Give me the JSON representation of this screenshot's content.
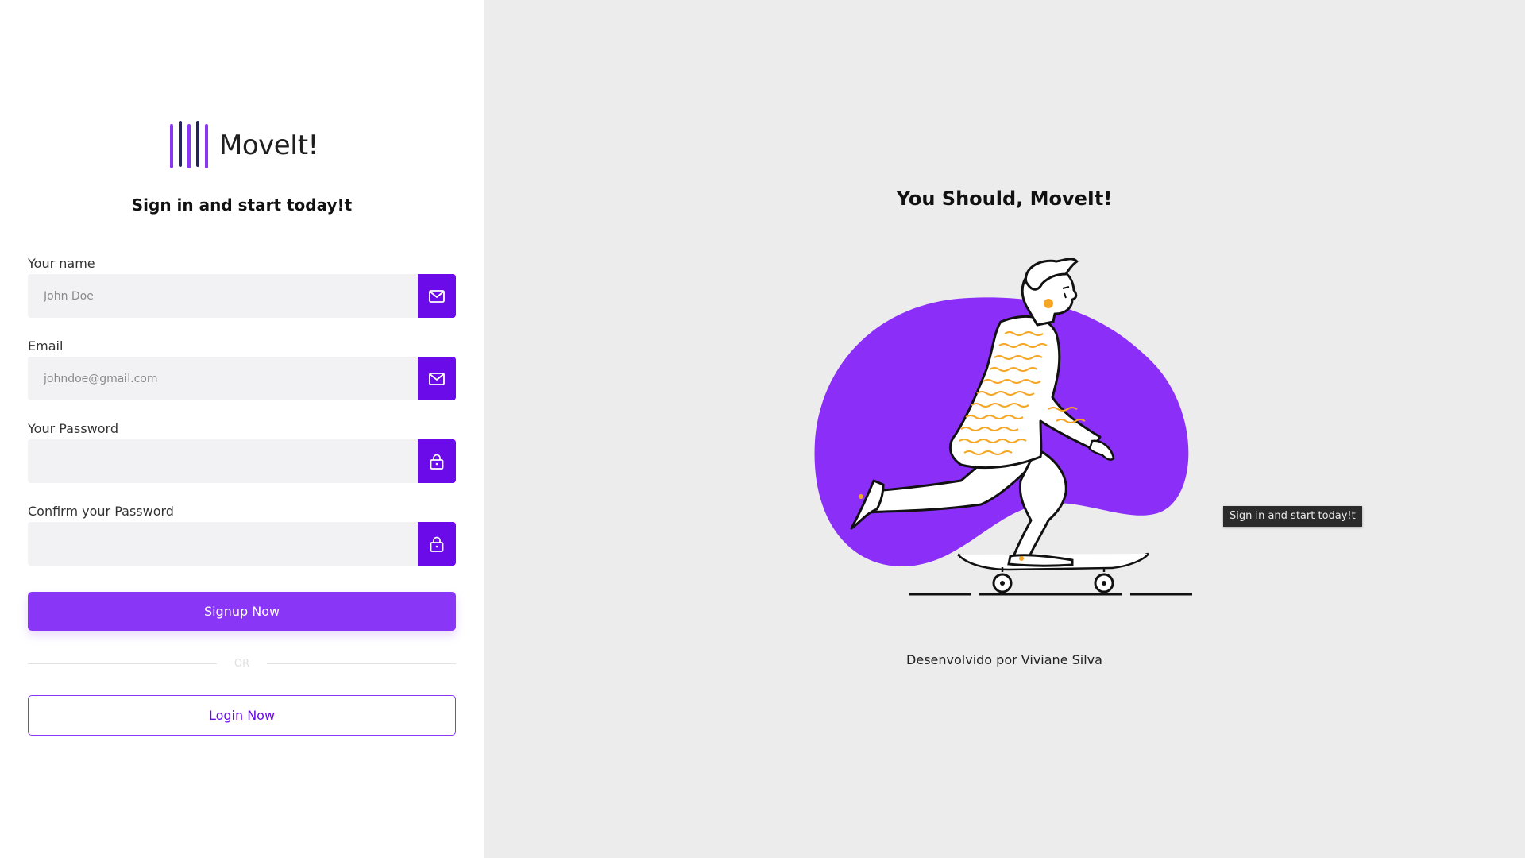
{
  "brand": {
    "name": "MoveIt!",
    "accent": "#8a36f7",
    "accent_dark": "#6b0bea"
  },
  "form": {
    "title": "Sign in and start today!t",
    "fields": [
      {
        "label": "Your name",
        "placeholder": "John Doe",
        "icon": "mail-icon",
        "type": "text"
      },
      {
        "label": "Email",
        "placeholder": "johndoe@gmail.com",
        "icon": "mail-icon",
        "type": "email"
      },
      {
        "label": "Your Password",
        "placeholder": "",
        "icon": "lock-icon",
        "type": "password"
      },
      {
        "label": "Confirm your Password",
        "placeholder": "",
        "icon": "lock-icon",
        "type": "password"
      }
    ],
    "signup_label": "Signup Now",
    "divider_text": "OR",
    "login_label": "Login Now"
  },
  "hero": {
    "title": "You Should, MoveIt!",
    "credit": "Desenvolvido por Viviane Silva"
  },
  "tooltip": {
    "text": "Sign in and start today!t"
  }
}
